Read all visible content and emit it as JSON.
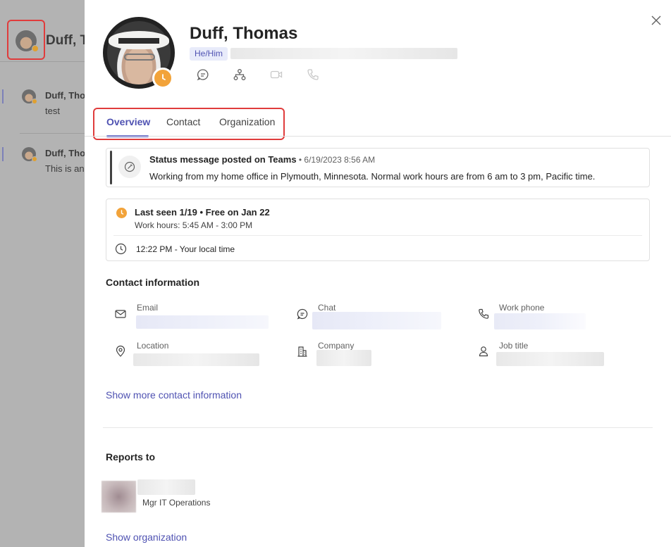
{
  "background": {
    "header_name": "Duff, T",
    "messages": [
      {
        "author": "Duff, Tho",
        "text": "test"
      },
      {
        "author": "Duff, Tho",
        "text": "This is an"
      }
    ]
  },
  "profile": {
    "name": "Duff, Thomas",
    "pronouns": "He/Him",
    "status_color": "#f2a33a",
    "actions": [
      {
        "icon": "chat-icon"
      },
      {
        "icon": "org-chart-icon"
      },
      {
        "icon": "video-call-icon"
      },
      {
        "icon": "phone-call-icon"
      }
    ]
  },
  "tabs": [
    {
      "label": "Overview",
      "active": true
    },
    {
      "label": "Contact",
      "active": false
    },
    {
      "label": "Organization",
      "active": false
    }
  ],
  "status_message": {
    "title": "Status message posted on Teams",
    "date": " • 6/19/2023 8:56 AM",
    "text": "Working from my home office in Plymouth, Minnesota. Normal work hours are from 6 am to 3 pm, Pacific time."
  },
  "availability": {
    "last_seen": "Last seen 1/19 • Free on Jan 22",
    "work_hours": "Work hours: 5:45 AM - 3:00 PM",
    "local_time": "12:22 PM - Your local time"
  },
  "contact": {
    "heading": "Contact information",
    "fields": {
      "email": "Email",
      "chat": "Chat",
      "work_phone": "Work phone",
      "location": "Location",
      "company": "Company",
      "job_title": "Job title"
    },
    "show_more": "Show more contact information"
  },
  "reports_to": {
    "heading": "Reports to",
    "manager_title": "Mgr IT Operations",
    "show_org": "Show organization"
  },
  "colors": {
    "accent": "#5b5fc7",
    "link": "#4f52b2",
    "highlight_border": "#e03c3c"
  }
}
